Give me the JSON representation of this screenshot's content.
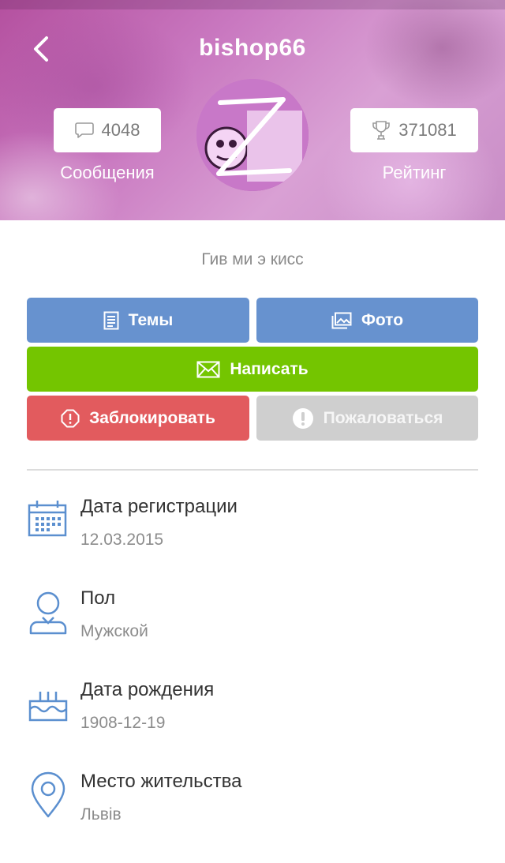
{
  "profile": {
    "username": "bishop66",
    "messages_count": "4048",
    "messages_label": "Сообщения",
    "rating_value": "371081",
    "rating_label": "Рейтинг",
    "status_text": "Гив ми э кисс"
  },
  "actions": {
    "topics_label": "Темы",
    "photo_label": "Фото",
    "write_label": "Написать",
    "block_label": "Заблокировать",
    "report_label": "Пожаловаться"
  },
  "info": [
    {
      "title": "Дата регистрации",
      "value": "12.03.2015",
      "icon": "calendar-icon"
    },
    {
      "title": "Пол",
      "value": "Мужской",
      "icon": "person-icon"
    },
    {
      "title": "Дата рождения",
      "value": "1908-12-19",
      "icon": "cake-icon"
    },
    {
      "title": "Место жительства",
      "value": "Львів",
      "icon": "location-pin-icon"
    }
  ],
  "colors": {
    "topics_button": "#6792cf",
    "write_button": "#74c500",
    "block_button": "#e25b5e",
    "report_button": "#cfcfcf",
    "info_icon": "#5b8fcf"
  }
}
